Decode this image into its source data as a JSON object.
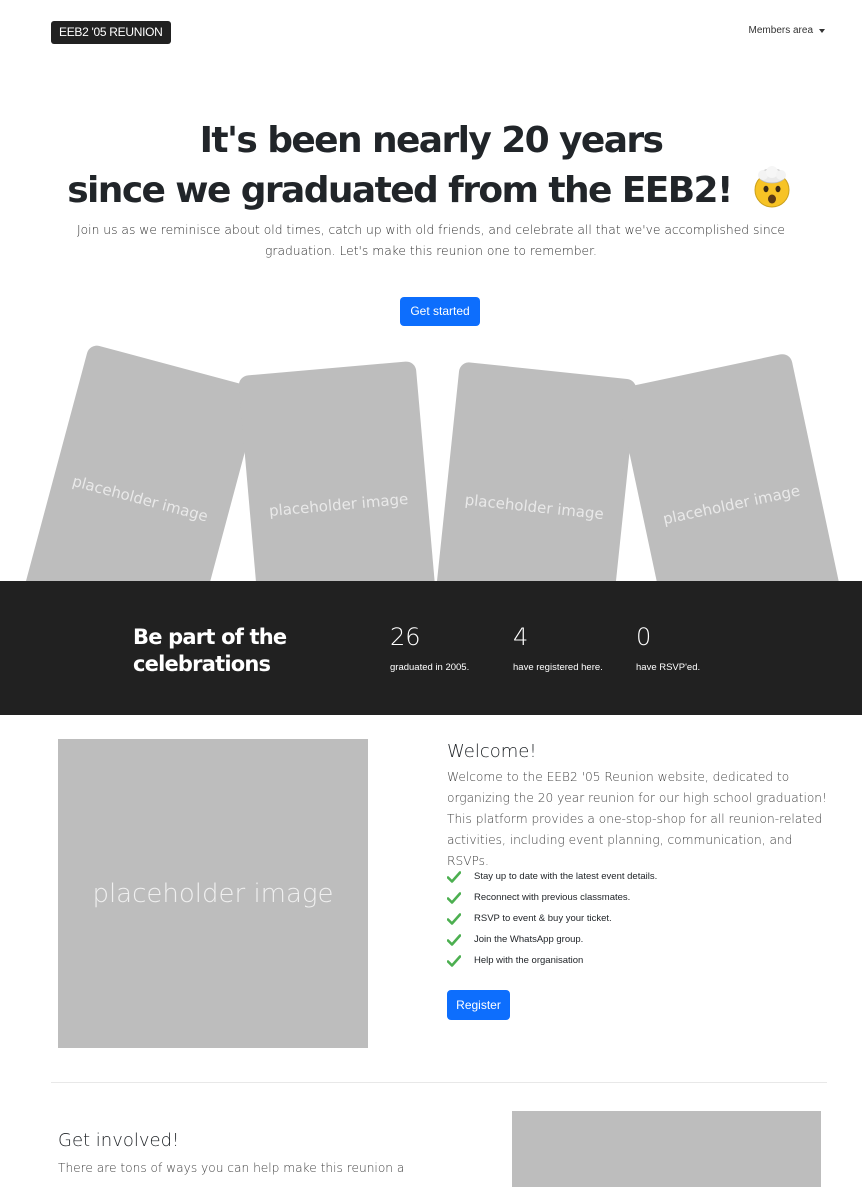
{
  "navbar": {
    "brand": "EEB2 '05 REUNION",
    "members_label": "Members area"
  },
  "hero": {
    "title_line1": "It's been nearly 20 years",
    "title_line2": "since we graduated from the EEB2!",
    "subtitle": "Join us as we reminisce about old times, catch up with old friends, and celebrate all that we've accomplished since graduation. Let's make this reunion one to remember.",
    "cta_label": "Get started"
  },
  "cards": [
    {
      "label": "placeholder image"
    },
    {
      "label": "placeholder image"
    },
    {
      "label": "placeholder image"
    },
    {
      "label": "placeholder image"
    }
  ],
  "stats": {
    "title": "Be part of the celebrations",
    "items": [
      {
        "value": "26",
        "label": "graduated in 2005."
      },
      {
        "value": "4",
        "label": "have registered here."
      },
      {
        "value": "0",
        "label": "have RSVP'ed."
      }
    ]
  },
  "welcome": {
    "image_label": "placeholder image",
    "title": "Welcome!",
    "text": "Welcome to the EEB2 '05 Reunion website, dedicated to organizing the 20 year reunion for our high school graduation! This platform provides a one-stop-shop for all reunion-related activities, including event planning, communication, and RSVPs.",
    "features": [
      "Stay up to date with the latest event details.",
      "Reconnect with previous classmates.",
      "RSVP to event & buy your ticket.",
      "Join the WhatsApp group.",
      "Help with the organisation"
    ],
    "register_label": "Register"
  },
  "involved": {
    "title": "Get involved!",
    "text": "There are tons of ways you can help make this reunion a"
  },
  "colors": {
    "primary": "#0d6efd",
    "dark": "#212121",
    "placeholder": "#bdbdbd",
    "check": "#4caf50"
  }
}
